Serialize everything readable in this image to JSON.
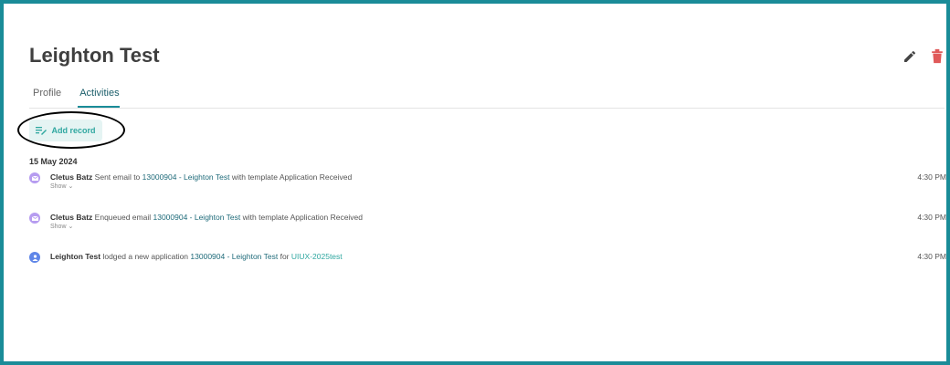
{
  "header": {
    "title": "Leighton Test"
  },
  "tabs": [
    {
      "label": "Profile",
      "active": false
    },
    {
      "label": "Activities",
      "active": true
    }
  ],
  "actions": {
    "add_record_label": "Add record"
  },
  "date_group": "15 May 2024",
  "activities": [
    {
      "actor": "Cletus Batz",
      "verb": "Sent email to",
      "ref": "13000904 - Leighton Test",
      "rest": "with template Application Received",
      "toggle": "Show",
      "time": "4:30 PM",
      "icon": "email-icon"
    },
    {
      "actor": "Cletus Batz",
      "verb": "Enqueued email",
      "ref": "13000904 - Leighton Test",
      "rest": "with template Application Received",
      "toggle": "Show",
      "time": "4:30 PM",
      "icon": "email-icon"
    },
    {
      "actor": "Leighton Test",
      "verb": "lodged a new application",
      "ref": "13000904 - Leighton Test",
      "rest": "for",
      "ref2": "UIUX-2025test",
      "time": "4:30 PM",
      "icon": "person-icon"
    }
  ],
  "colors": {
    "frame_border": "#1a8c98",
    "accent": "#2fa7a0",
    "link": "#1f6b7a",
    "delete": "#e05a5a",
    "email_icon_bg": "#b69cf0",
    "person_icon_bg": "#5f86e8"
  }
}
